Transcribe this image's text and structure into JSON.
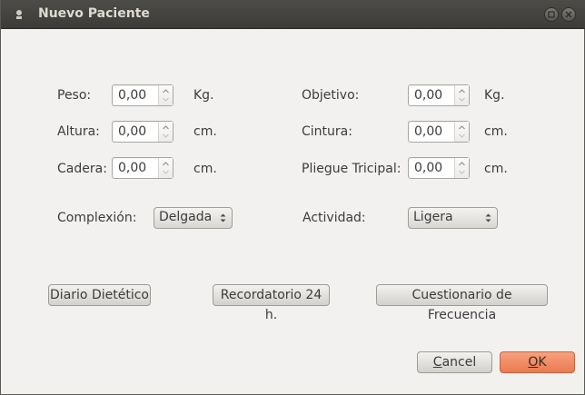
{
  "window": {
    "title": "Nuevo Paciente"
  },
  "fields": {
    "peso": {
      "label": "Peso:",
      "value": "0,00",
      "unit": "Kg."
    },
    "altura": {
      "label": "Altura:",
      "value": "0,00",
      "unit": "cm."
    },
    "cadera": {
      "label": "Cadera:",
      "value": "0,00",
      "unit": "cm."
    },
    "objetivo": {
      "label": "Objetivo:",
      "value": "0,00",
      "unit": "Kg."
    },
    "cintura": {
      "label": "Cintura:",
      "value": "0,00",
      "unit": "cm."
    },
    "pliegue": {
      "label": "Pliegue Tricipal:",
      "value": "0,00",
      "unit": "cm."
    }
  },
  "complexion": {
    "label": "Complexión:",
    "selected": "Delgada"
  },
  "actividad": {
    "label": "Actividad:",
    "selected": "Ligera"
  },
  "buttons": {
    "diario": "Diario Dietético",
    "recordatorio": "Recordatorio 24 h.",
    "cuestionario": "Cuestionario de Frecuencia",
    "cancel_mnemonic": "C",
    "cancel_rest": "ancel",
    "ok_mnemonic": "O",
    "ok_rest": "K"
  },
  "colors": {
    "titlebar": "#3c3b37",
    "ok_button": "#eb7a4f",
    "background": "#f2f1f0"
  }
}
